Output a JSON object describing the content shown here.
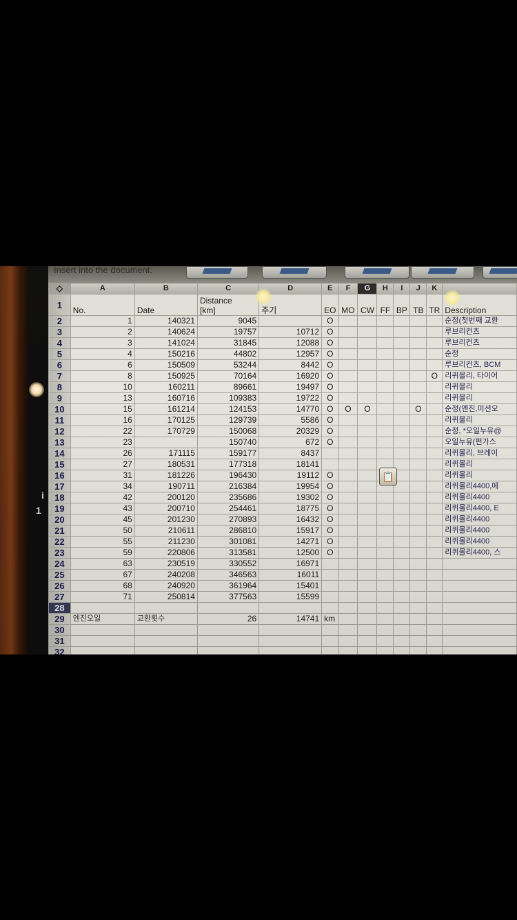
{
  "toolbar": {
    "hint": "Insert into the document."
  },
  "bezel": {
    "marks": [
      "i",
      "1"
    ]
  },
  "columns": [
    "A",
    "B",
    "C",
    "D",
    "E",
    "F",
    "G",
    "H",
    "I",
    "J",
    "K"
  ],
  "header_row": {
    "no": "No.",
    "date": "Date",
    "distance": "Distance\n[km]",
    "cycle": "주기",
    "eo": "EO",
    "mo": "MO",
    "cw": "CW",
    "ff": "FF",
    "bp": "BP",
    "tb": "TB",
    "tr": "TR",
    "description": "Description"
  },
  "rows": [
    {
      "r": "2",
      "no": "1",
      "date": "140321",
      "dist": "9045",
      "cycle": "",
      "eo": "O",
      "mo": "",
      "cw": "",
      "ff": "",
      "bp": "",
      "tb": "",
      "tr": "",
      "desc": "순정(첫번째 교환"
    },
    {
      "r": "3",
      "no": "2",
      "date": "140624",
      "dist": "19757",
      "cycle": "10712",
      "eo": "O",
      "mo": "",
      "cw": "",
      "ff": "",
      "bp": "",
      "tb": "",
      "tr": "",
      "desc": "루브리컨츠"
    },
    {
      "r": "4",
      "no": "3",
      "date": "141024",
      "dist": "31845",
      "cycle": "12088",
      "eo": "O",
      "mo": "",
      "cw": "",
      "ff": "",
      "bp": "",
      "tb": "",
      "tr": "",
      "desc": "루브리컨츠"
    },
    {
      "r": "5",
      "no": "4",
      "date": "150216",
      "dist": "44802",
      "cycle": "12957",
      "eo": "O",
      "mo": "",
      "cw": "",
      "ff": "",
      "bp": "",
      "tb": "",
      "tr": "",
      "desc": "순정"
    },
    {
      "r": "6",
      "no": "6",
      "date": "150509",
      "dist": "53244",
      "cycle": "8442",
      "eo": "O",
      "mo": "",
      "cw": "",
      "ff": "",
      "bp": "",
      "tb": "",
      "tr": "",
      "desc": "루브리컨츠, BCM"
    },
    {
      "r": "7",
      "no": "8",
      "date": "150925",
      "dist": "70164",
      "cycle": "16920",
      "eo": "O",
      "mo": "",
      "cw": "",
      "ff": "",
      "bp": "",
      "tb": "",
      "tr": "O",
      "desc": "리퀴몰리, 타이어"
    },
    {
      "r": "8",
      "no": "10",
      "date": "160211",
      "dist": "89661",
      "cycle": "19497",
      "eo": "O",
      "mo": "",
      "cw": "",
      "ff": "",
      "bp": "",
      "tb": "",
      "tr": "",
      "desc": "리퀴몰리"
    },
    {
      "r": "9",
      "no": "13",
      "date": "160716",
      "dist": "109383",
      "cycle": "19722",
      "eo": "O",
      "mo": "",
      "cw": "",
      "ff": "",
      "bp": "",
      "tb": "",
      "tr": "",
      "desc": "리퀴몰리"
    },
    {
      "r": "10",
      "no": "15",
      "date": "161214",
      "dist": "124153",
      "cycle": "14770",
      "eo": "O",
      "mo": "O",
      "cw": "O",
      "ff": "",
      "bp": "",
      "tb": "O",
      "tr": "",
      "desc": "순정(엔진,미션오"
    },
    {
      "r": "11",
      "no": "16",
      "date": "170125",
      "dist": "129739",
      "cycle": "5586",
      "eo": "O",
      "mo": "",
      "cw": "",
      "ff": "",
      "bp": "",
      "tb": "",
      "tr": "",
      "desc": "리퀴몰리"
    },
    {
      "r": "12",
      "no": "22",
      "date": "170729",
      "dist": "150068",
      "cycle": "20329",
      "eo": "O",
      "mo": "",
      "cw": "",
      "ff": "",
      "bp": "",
      "tb": "",
      "tr": "",
      "desc": "순정, *오일누유@"
    },
    {
      "r": "13",
      "no": "23",
      "date": "",
      "dist": "150740",
      "cycle": "672",
      "eo": "O",
      "mo": "",
      "cw": "",
      "ff": "",
      "bp": "",
      "tb": "",
      "tr": "",
      "desc": "오일누유(펀가스"
    },
    {
      "r": "14",
      "no": "26",
      "date": "171115",
      "dist": "159177",
      "cycle": "8437",
      "eo": "",
      "mo": "",
      "cw": "",
      "ff": "",
      "bp": "",
      "tb": "",
      "tr": "",
      "desc": "리퀴몰리, 브레이"
    },
    {
      "r": "15",
      "no": "27",
      "date": "180531",
      "dist": "177318",
      "cycle": "18141",
      "eo": "",
      "mo": "",
      "cw": "",
      "ff": "",
      "bp": "",
      "tb": "",
      "tr": "",
      "desc": "리퀴몰리"
    },
    {
      "r": "16",
      "no": "31",
      "date": "181226",
      "dist": "196430",
      "cycle": "19112",
      "eo": "O",
      "mo": "",
      "cw": "",
      "ff": "",
      "bp": "",
      "tb": "",
      "tr": "",
      "desc": "리퀴몰리"
    },
    {
      "r": "17",
      "no": "34",
      "date": "190711",
      "dist": "216384",
      "cycle": "19954",
      "eo": "O",
      "mo": "",
      "cw": "",
      "ff": "",
      "bp": "",
      "tb": "",
      "tr": "",
      "desc": "리퀴몰리4400,에"
    },
    {
      "r": "18",
      "no": "42",
      "date": "200120",
      "dist": "235686",
      "cycle": "19302",
      "eo": "O",
      "mo": "",
      "cw": "",
      "ff": "",
      "bp": "",
      "tb": "",
      "tr": "",
      "desc": "리퀴몰리4400"
    },
    {
      "r": "19",
      "no": "43",
      "date": "200710",
      "dist": "254461",
      "cycle": "18775",
      "eo": "O",
      "mo": "",
      "cw": "",
      "ff": "",
      "bp": "",
      "tb": "",
      "tr": "",
      "desc": "리퀴몰리4400, E"
    },
    {
      "r": "20",
      "no": "45",
      "date": "201230",
      "dist": "270893",
      "cycle": "16432",
      "eo": "O",
      "mo": "",
      "cw": "",
      "ff": "",
      "bp": "",
      "tb": "",
      "tr": "",
      "desc": "리퀴몰리4400"
    },
    {
      "r": "21",
      "no": "50",
      "date": "210611",
      "dist": "286810",
      "cycle": "15917",
      "eo": "O",
      "mo": "",
      "cw": "",
      "ff": "",
      "bp": "",
      "tb": "",
      "tr": "",
      "desc": "리퀴몰리4400"
    },
    {
      "r": "22",
      "no": "55",
      "date": "211230",
      "dist": "301081",
      "cycle": "14271",
      "eo": "O",
      "mo": "",
      "cw": "",
      "ff": "",
      "bp": "",
      "tb": "",
      "tr": "",
      "desc": "리퀴몰리4400"
    },
    {
      "r": "23",
      "no": "59",
      "date": "220806",
      "dist": "313581",
      "cycle": "12500",
      "eo": "O",
      "mo": "",
      "cw": "",
      "ff": "",
      "bp": "",
      "tb": "",
      "tr": "",
      "desc": "리퀴몰리4400, 스"
    },
    {
      "r": "24",
      "no": "63",
      "date": "230519",
      "dist": "330552",
      "cycle": "16971",
      "eo": "",
      "mo": "",
      "cw": "",
      "ff": "",
      "bp": "",
      "tb": "",
      "tr": "",
      "desc": ""
    },
    {
      "r": "25",
      "no": "67",
      "date": "240208",
      "dist": "346563",
      "cycle": "16011",
      "eo": "",
      "mo": "",
      "cw": "",
      "ff": "",
      "bp": "",
      "tb": "",
      "tr": "",
      "desc": ""
    },
    {
      "r": "26",
      "no": "68",
      "date": "240920",
      "dist": "361964",
      "cycle": "15401",
      "eo": "",
      "mo": "",
      "cw": "",
      "ff": "",
      "bp": "",
      "tb": "",
      "tr": "",
      "desc": ""
    },
    {
      "r": "27",
      "no": "71",
      "date": "250814",
      "dist": "377563",
      "cycle": "15599",
      "eo": "",
      "mo": "",
      "cw": "",
      "ff": "",
      "bp": "",
      "tb": "",
      "tr": "",
      "desc": ""
    }
  ],
  "row28": {
    "r": "28"
  },
  "summary": {
    "r": "29",
    "label_a": "엔진오일",
    "label_b": "교환횟수",
    "count": "26",
    "avg": "14741",
    "unit": "km"
  },
  "empty_rows": [
    "30",
    "31",
    "32"
  ]
}
